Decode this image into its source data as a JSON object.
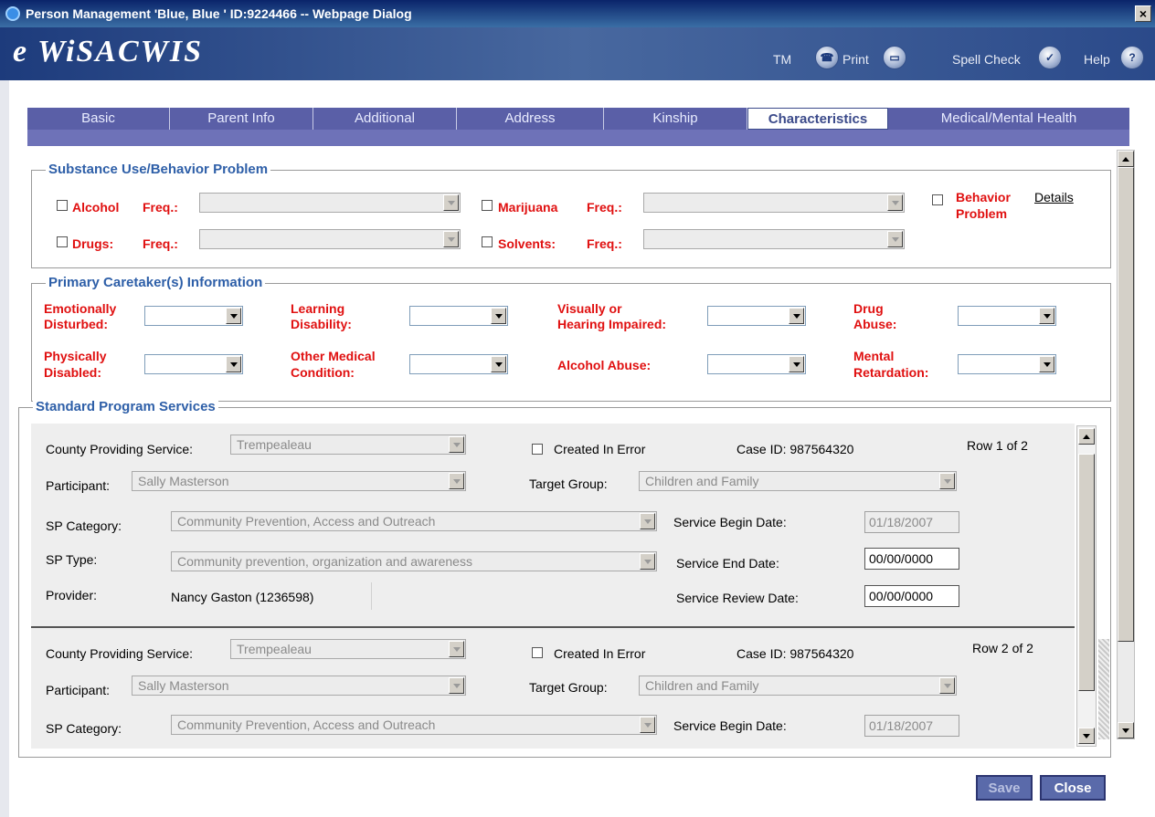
{
  "window": {
    "title": "Person Management 'Blue, Blue ' ID:9224466 -- Webpage Dialog",
    "close_symbol": "×"
  },
  "app": {
    "logo": "e WiSACWIS"
  },
  "toolbar": {
    "tm": "TM",
    "print": "Print",
    "spell_check": "Spell Check",
    "help": "Help"
  },
  "tabs": [
    "Basic",
    "Parent Info",
    "Additional",
    "Address",
    "Kinship",
    "Characteristics",
    "Medical/Mental Health"
  ],
  "active_tab": "Characteristics",
  "substance": {
    "legend": "Substance Use/Behavior Problem",
    "alcohol": "Alcohol",
    "drugs": "Drugs:",
    "marijuana": "Marijuana",
    "solvents": "Solvents:",
    "freq": "Freq.:",
    "behavior_line1": "Behavior",
    "behavior_line2": "Problem",
    "details": "Details"
  },
  "caretaker": {
    "legend": "Primary Caretaker(s) Information",
    "emotionally_1": "Emotionally",
    "emotionally_2": "Disturbed:",
    "learning_1": "Learning",
    "learning_2": "Disability:",
    "visually_1": "Visually or",
    "visually_2": "Hearing Impaired:",
    "drug_1": "Drug",
    "drug_2": "Abuse:",
    "physically_1": "Physically",
    "physically_2": "Disabled:",
    "other_1": "Other Medical",
    "other_2": "Condition:",
    "alcohol_abuse": "Alcohol Abuse:",
    "mental_1": "Mental",
    "mental_2": "Retardation:"
  },
  "sps": {
    "legend": "Standard Program Services",
    "labels": {
      "county": "County Providing Service:",
      "created_in_error": "Created In Error",
      "participant": "Participant:",
      "target_group": "Target Group:",
      "sp_category": "SP Category:",
      "sp_type": "SP Type:",
      "provider": "Provider:",
      "begin": "Service Begin Date:",
      "end": "Service End Date:",
      "review": "Service Review Date:"
    },
    "rows": [
      {
        "county": "Trempealeau",
        "case_id": "Case ID:  987564320",
        "row": "Row 1 of 2",
        "participant": "Sally Masterson",
        "target_group": "Children and Family",
        "sp_category": "Community Prevention, Access and Outreach",
        "sp_type": "Community prevention, organization and awareness",
        "provider": "Nancy Gaston (1236598)",
        "begin": "01/18/2007",
        "end": "00/00/0000",
        "review": "00/00/0000"
      },
      {
        "county": "Trempealeau",
        "case_id": "Case ID:  987564320",
        "row": "Row 2 of 2",
        "participant": "Sally Masterson",
        "target_group": "Children and Family",
        "sp_category": "Community Prevention, Access and Outreach",
        "begin": "01/18/2007"
      }
    ]
  },
  "buttons": {
    "save": "Save",
    "close": "Close"
  }
}
